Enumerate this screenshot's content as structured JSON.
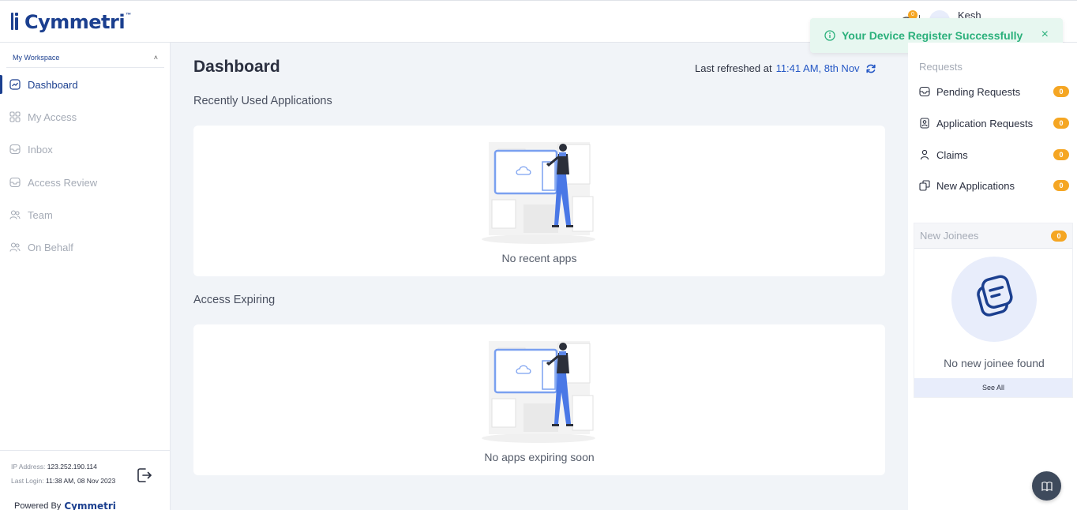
{
  "brand": {
    "name": "Cymmetri",
    "tm": "™"
  },
  "header": {
    "notification_count": "0",
    "username": "Kesh"
  },
  "toast": {
    "message": "Your Device Register Successfully",
    "close": "×"
  },
  "sidebar": {
    "workspace_label": "My Workspace",
    "items": [
      {
        "label": "Dashboard",
        "icon": "dashboard-icon"
      },
      {
        "label": "My Access",
        "icon": "grid-icon"
      },
      {
        "label": "Inbox",
        "icon": "inbox-icon"
      },
      {
        "label": "Access Review",
        "icon": "review-icon"
      },
      {
        "label": "Team",
        "icon": "team-icon"
      },
      {
        "label": "On Behalf",
        "icon": "users-icon"
      }
    ],
    "ip_label": "IP Address:",
    "ip_value": "123.252.190.114",
    "last_login_label": "Last Login:",
    "last_login_value": "11:38 AM, 08 Nov 2023",
    "powered_by": "Powered By"
  },
  "main": {
    "title": "Dashboard",
    "refresh_label": "Last refreshed at",
    "refresh_time": "11:41 AM, 8th Nov",
    "recent_title": "Recently Used Applications",
    "recent_empty": "No recent apps",
    "expiring_title": "Access Expiring",
    "expiring_empty": "No apps expiring soon"
  },
  "requests": {
    "title": "Requests",
    "items": [
      {
        "label": "Pending Requests",
        "count": "0"
      },
      {
        "label": "Application Requests",
        "count": "0"
      },
      {
        "label": "Claims",
        "count": "0"
      },
      {
        "label": "New Applications",
        "count": "0"
      }
    ]
  },
  "joinees": {
    "title": "New Joinees",
    "count": "0",
    "empty": "No new joinee found",
    "see_all": "See All"
  },
  "colors": {
    "brand": "#1b3f8f",
    "accent": "#2457c5",
    "badge": "#f5a623",
    "success": "#2bb07b"
  }
}
